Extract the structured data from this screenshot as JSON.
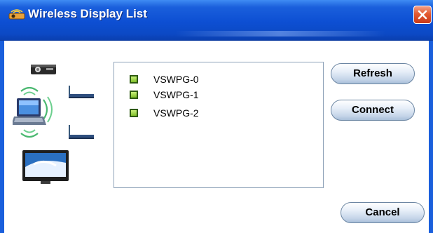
{
  "window": {
    "title": "Wireless Display List",
    "title_icon": "projector-wireless-icon",
    "close_icon": "close-icon"
  },
  "colors": {
    "titlebar": "#0d4fd3",
    "close_button": "#e45a30",
    "list_border": "#8ea2b8",
    "checkbox": "#7fbf2a"
  },
  "illustration": {
    "icons": [
      "projector-icon",
      "wifi-access-point-icon",
      "laptop-icon",
      "wireless-signal-icon",
      "wifi-access-point-icon",
      "tv-icon"
    ]
  },
  "display_list": {
    "items": [
      {
        "label": "VSWPG-0",
        "checked": false
      },
      {
        "label": "VSWPG-1",
        "checked": false
      },
      {
        "label": "VSWPG-2",
        "checked": false
      }
    ]
  },
  "buttons": {
    "refresh": "Refresh",
    "connect": "Connect",
    "cancel": "Cancel"
  }
}
